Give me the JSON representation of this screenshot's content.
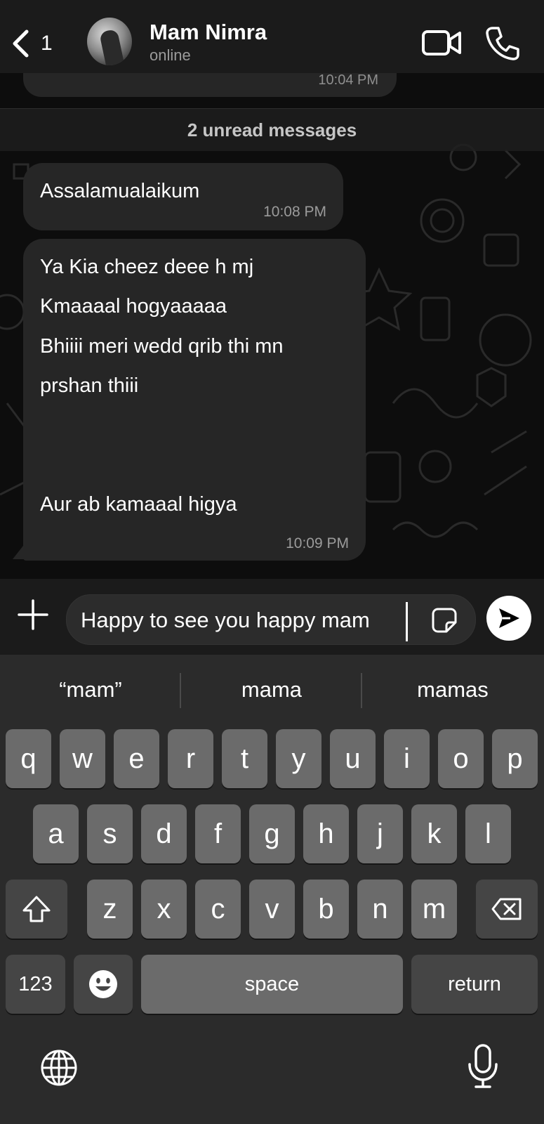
{
  "header": {
    "back_count": "1",
    "contact_name": "Mam Nimra",
    "contact_status": "online"
  },
  "chat": {
    "previous_message_time": "10:04 PM",
    "unread_banner": "2 unread messages",
    "messages": [
      {
        "text": "Assalamualaikum",
        "time": "10:08 PM"
      },
      {
        "lines": [
          "Ya Kia cheez deee h mj",
          "Kmaaaal hogyaaaaa",
          "Bhiiii meri  wedd qrib thi mn",
          "prshan thiii",
          "Aur ab kamaaal higya"
        ],
        "time": "10:09 PM"
      }
    ]
  },
  "composer": {
    "input_value": "Happy to see you happy mam"
  },
  "keyboard": {
    "suggestions": [
      "“mam”",
      "mama",
      "mamas"
    ],
    "row1": [
      "q",
      "w",
      "e",
      "r",
      "t",
      "y",
      "u",
      "i",
      "o",
      "p"
    ],
    "row2": [
      "a",
      "s",
      "d",
      "f",
      "g",
      "h",
      "j",
      "k",
      "l"
    ],
    "row3": [
      "z",
      "x",
      "c",
      "v",
      "b",
      "n",
      "m"
    ],
    "numbers_label": "123",
    "space_label": "space",
    "return_label": "return"
  },
  "colors": {
    "background": "#0b0b0b",
    "bubble": "#262626",
    "header": "#1b1b1b",
    "key": "#6b6b6b",
    "key_dark": "#454545"
  },
  "icons": [
    "chevron-left-icon",
    "video-camera-icon",
    "phone-icon",
    "plus-icon",
    "sticker-icon",
    "send-icon",
    "shift-icon",
    "backspace-icon",
    "emoji-icon",
    "globe-icon",
    "microphone-icon"
  ]
}
